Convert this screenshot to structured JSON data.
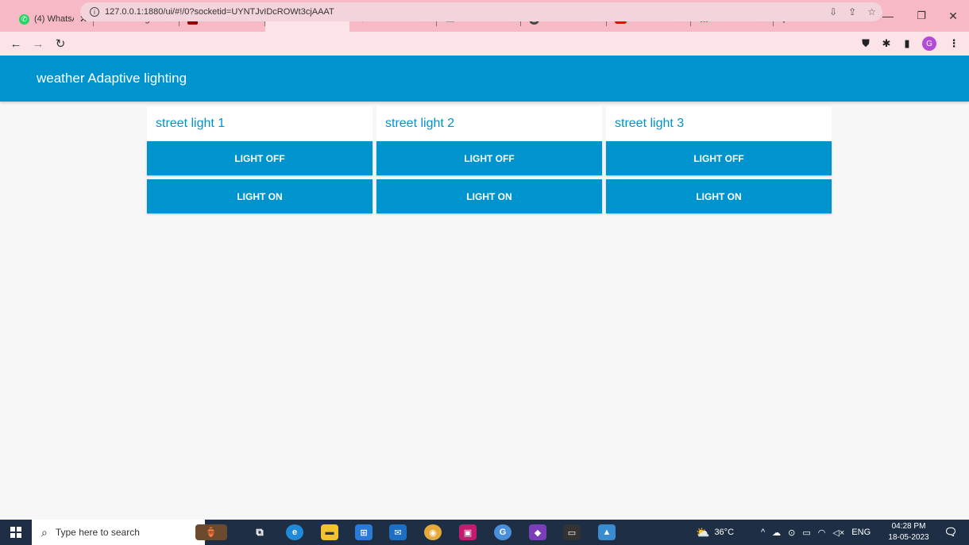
{
  "browser": {
    "tabs": [
      {
        "label": "(4) WhatsA",
        "icon": "whatsapp-icon",
        "color": "#25d366",
        "active": false
      },
      {
        "label": "street ligh",
        "icon": "wikipedia-icon",
        "color": "#000000",
        "active": false
      },
      {
        "label": "Node-RED",
        "icon": "node-red-icon",
        "color": "#8f0000",
        "active": false
      },
      {
        "label": "Node-RED",
        "icon": "node-red-dashboard-icon",
        "color": "#555555",
        "active": true
      },
      {
        "label": "IBM Watso",
        "icon": "ibm-watson-icon",
        "color": "#333333",
        "active": false
      },
      {
        "label": "Internet of",
        "icon": "cloud-icon",
        "color": "#bbbbbb",
        "active": false
      },
      {
        "label": "New Tab",
        "icon": "chrome-icon",
        "color": "#444444",
        "active": false
      },
      {
        "label": "how to co",
        "icon": "youtube-icon",
        "color": "#ff0000",
        "active": false
      },
      {
        "label": "Welcome",
        "icon": "gmail-icon",
        "color": "#d93025",
        "active": false
      }
    ],
    "url": "127.0.0.1:1880/ui/#!/0?socketid=UYNTJvIDcROWt3cjAAAT",
    "profile_initial": "G"
  },
  "dashboard": {
    "title": "weather Adaptive lighting",
    "accent_color": "#0094ce",
    "groups": [
      {
        "title": "street light 1",
        "off_label": "LIGHT OFF",
        "on_label": "LIGHT ON"
      },
      {
        "title": "street light 2",
        "off_label": "LIGHT OFF",
        "on_label": "LIGHT ON"
      },
      {
        "title": "street light 3",
        "off_label": "LIGHT OFF",
        "on_label": "LIGHT ON"
      }
    ]
  },
  "taskbar": {
    "search_placeholder": "Type here to search",
    "temperature": "36°C",
    "language": "ENG",
    "time": "04:28 PM",
    "date": "18-05-2023"
  }
}
